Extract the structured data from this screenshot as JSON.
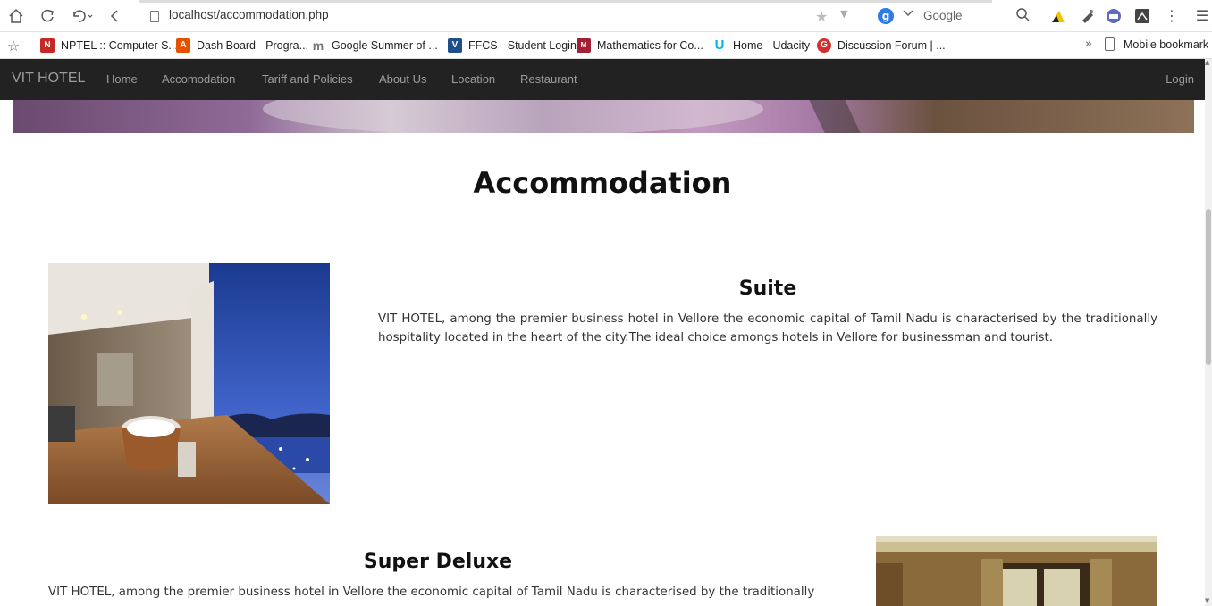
{
  "browser": {
    "url": "localhost/accommodation.php",
    "search_engine_letter": "g",
    "search_placeholder": "Google",
    "bookmarks": [
      {
        "label": "NPTEL :: Computer S...",
        "icon_letter": "N",
        "color": "#c62828"
      },
      {
        "label": "Dash Board - Progra...",
        "icon_letter": "A",
        "color": "#e65100"
      },
      {
        "label": "Google Summer of ...",
        "icon_letter": "m",
        "color": "#777777"
      },
      {
        "label": "FFCS - Student Login",
        "icon_letter": "V",
        "color": "#1e4e8c"
      },
      {
        "label": "Mathematics for Co...",
        "icon_letter": "M",
        "color": "#a31f34"
      },
      {
        "label": "Home - Udacity",
        "icon_letter": "U",
        "color": "#02b3e4"
      },
      {
        "label": "Discussion Forum | ...",
        "icon_letter": "G",
        "color": "#d32f2f"
      }
    ],
    "mobile_bookmarks": "Mobile bookmark"
  },
  "navbar": {
    "brand": "VIT HOTEL",
    "links": [
      "Home",
      "Accomodation",
      "Tariff and Policies",
      "About Us",
      "Location",
      "Restaurant"
    ],
    "login": "Login"
  },
  "page": {
    "title": "Accommodation",
    "rooms": [
      {
        "name": "Suite",
        "description": "VIT HOTEL, among the premier business hotel in Vellore the economic capital of Tamil Nadu is characterised by the traditionally hospitality located in the heart of the city.The ideal choice amongs hotels in Vellore for businessman and tourist."
      },
      {
        "name": "Super Deluxe",
        "description": "VIT HOTEL, among the premier business hotel in Vellore the economic capital of Tamil Nadu is characterised by the traditionally"
      }
    ]
  },
  "colors": {
    "navbar_bg": "#222222",
    "navbar_text": "#9d9d9d"
  }
}
